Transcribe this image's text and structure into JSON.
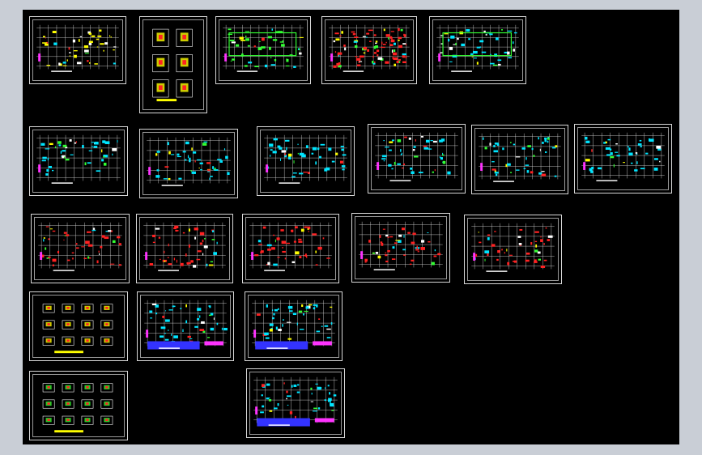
{
  "viewport": {
    "background": "#c9ced6",
    "canvas_color": "#000000"
  },
  "palette": {
    "grid": "#e8e8e8",
    "cyan": "#00e5ff",
    "yellow": "#ffff00",
    "green": "#33ff33",
    "red": "#ff2222",
    "magenta": "#ff33ff",
    "blue": "#3333ff",
    "white": "#ffffff"
  },
  "sheets": [
    {
      "id": "sheet-1",
      "style": "plan-yellow"
    },
    {
      "id": "sheet-2",
      "style": "details-columns"
    },
    {
      "id": "sheet-3",
      "style": "plan-green"
    },
    {
      "id": "sheet-4",
      "style": "plan-red-dense"
    },
    {
      "id": "sheet-5",
      "style": "plan-small"
    },
    {
      "id": "sheet-6",
      "style": "plan-cyan"
    },
    {
      "id": "sheet-7",
      "style": "plan-cyan"
    },
    {
      "id": "sheet-8",
      "style": "plan-cyan"
    },
    {
      "id": "sheet-9",
      "style": "plan-cyan"
    },
    {
      "id": "sheet-10",
      "style": "plan-cyan"
    },
    {
      "id": "sheet-11",
      "style": "plan-cyan-light"
    },
    {
      "id": "sheet-12",
      "style": "plan-red"
    },
    {
      "id": "sheet-13",
      "style": "plan-red"
    },
    {
      "id": "sheet-14",
      "style": "plan-red-cyan"
    },
    {
      "id": "sheet-15",
      "style": "plan-white-red"
    },
    {
      "id": "sheet-16",
      "style": "plan-white-red"
    },
    {
      "id": "sheet-17",
      "style": "details-grid"
    },
    {
      "id": "sheet-18",
      "style": "foundation-blue"
    },
    {
      "id": "sheet-19",
      "style": "foundation-blue"
    },
    {
      "id": "sheet-20",
      "style": "details-grid-green"
    },
    {
      "id": "sheet-21",
      "style": "foundation-blue"
    }
  ]
}
